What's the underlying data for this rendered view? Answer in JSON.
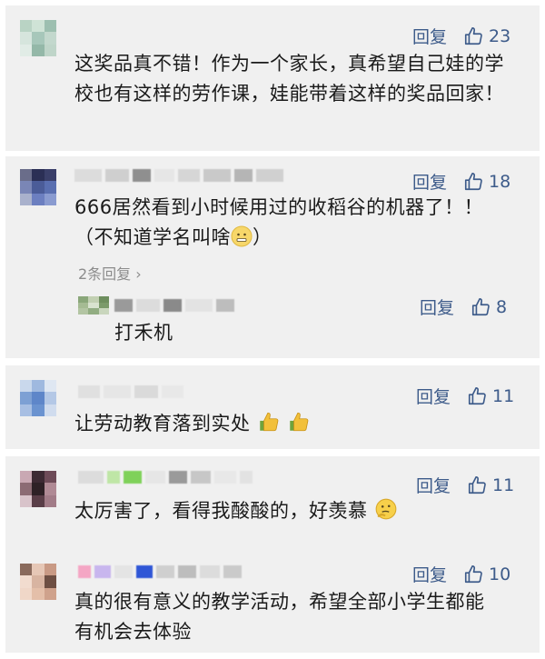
{
  "comments": [
    {
      "reply_label": "回复",
      "likes": "23",
      "text": "这奖品真不错！作为一个家长，真希望自己娃的学校也有这样的劳作课，娃能带着这样的奖品回家！"
    },
    {
      "reply_label": "回复",
      "likes": "18",
      "text_line1": "666居然看到小时候用过的收稻谷的机器了！！",
      "text_line2_a": "（不知道学名叫啥",
      "text_line2_b": "）",
      "replies_link": "2条回复",
      "sub_reply": {
        "reply_label": "回复",
        "likes": "8",
        "text": "打禾机"
      }
    },
    {
      "reply_label": "回复",
      "likes": "11",
      "text": "让劳动教育落到实处"
    },
    {
      "reply_label": "回复",
      "likes": "11",
      "text": "太厉害了，看得我酸酸的，好羡慕"
    },
    {
      "reply_label": "回复",
      "likes": "10",
      "text": "真的很有意义的教学活动，希望全部小学生都能有机会去体验"
    }
  ],
  "colors": {
    "link": "#3d5b8a",
    "card_bg": "#f0f0f0",
    "muted": "#8c8c8c"
  },
  "icons": {
    "like": "thumbs-up-outline-icon",
    "chevron": "chevron-right-icon"
  }
}
